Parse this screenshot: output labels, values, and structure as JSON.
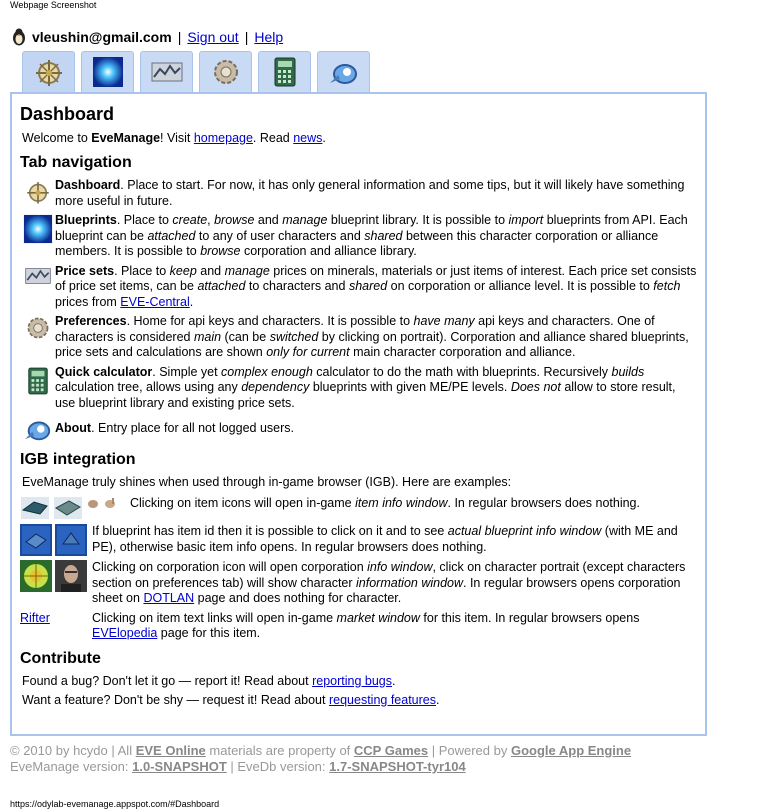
{
  "caption": "Webpage Screenshot",
  "status_url": "https://odylab-evemanage.appspot.com/#Dashboard",
  "user": {
    "email": "vleushin@gmail.com",
    "sign_out": "Sign out",
    "help": "Help",
    "sep": "|"
  },
  "tabs": [
    {
      "icon": "dashboard-compass-icon"
    },
    {
      "icon": "blueprint-glow-icon"
    },
    {
      "icon": "price-chart-icon"
    },
    {
      "icon": "preferences-gear-icon"
    },
    {
      "icon": "calculator-icon"
    },
    {
      "icon": "about-satellite-icon"
    }
  ],
  "dashboard": {
    "title": "Dashboard",
    "welcome_pre": "Welcome to ",
    "welcome_brand": "EveManage",
    "welcome_mid": "! Visit ",
    "homepage": "homepage",
    "welcome_read": ". Read ",
    "news": "news",
    "welcome_end": "."
  },
  "tabnav": {
    "title": "Tab navigation",
    "dash_name": "Dashboard",
    "dash_text": ". Place to start. For now, it has only general information and some tips, but it will likely have something more useful in future.",
    "bp_name": "Blueprints",
    "bp_t1": ". Place to ",
    "bp_i1": "create",
    "bp_t2": ", ",
    "bp_i2": "browse",
    "bp_t3": " and ",
    "bp_i3": "manage",
    "bp_t4": " blueprint library. It is possible to ",
    "bp_i4": "import",
    "bp_t5": " blueprints from API. Each blueprint can be ",
    "bp_i5": "attached",
    "bp_t6": " to any of user characters and ",
    "bp_i6": "shared",
    "bp_t7": " between this character corporation or alliance members. It is possible to ",
    "bp_i7": "browse",
    "bp_t8": " corporation and alliance library.",
    "ps_name": "Price sets",
    "ps_t1": ". Place to ",
    "ps_i1": "keep",
    "ps_t2": " and ",
    "ps_i2": "manage",
    "ps_t3": " prices on minerals, materials or just items of interest. Each price set consists of price set items, can be ",
    "ps_i3": "attached",
    "ps_t4": " to characters and ",
    "ps_i4": "shared",
    "ps_t5": " on corporation or alliance level. It is possible to ",
    "ps_i5": "fetch",
    "ps_t6": " prices from ",
    "ps_link": "EVE-Central",
    "ps_t7": ".",
    "pr_name": "Preferences",
    "pr_t1": ". Home for api keys and characters. It is possible to ",
    "pr_i1": "have many",
    "pr_t2": " api keys and characters. One of characters is considered ",
    "pr_i2": "main",
    "pr_t3": " (can be ",
    "pr_i3": "switched",
    "pr_t4": " by clicking on portrait). Corporation and alliance shared blueprints, price sets and calculations are shown ",
    "pr_i4": "only for current",
    "pr_t5": " main character corporation and alliance.",
    "qc_name": "Quick calculator",
    "qc_t1": ". Simple yet ",
    "qc_i1": "complex enough",
    "qc_t2": " calculator to do the math with blueprints. Recursively ",
    "qc_i2": "builds",
    "qc_t3": " calculation tree, allows using any ",
    "qc_i3": "dependency",
    "qc_t4": " blueprints with given ME/PE levels. ",
    "qc_i4": "Does not",
    "qc_t5": " allow to store result, use blueprint library and existing price sets.",
    "ab_name": "About",
    "ab_text": ". Entry place for all not logged users."
  },
  "igb": {
    "title": "IGB integration",
    "intro": "EveManage truly shines when used through in-game browser (IGB). Here are examples:",
    "r1_t1": "Clicking on item icons will open in-game ",
    "r1_i1": "item info window",
    "r1_t2": ". In regular browsers does nothing.",
    "r2_t1": "If blueprint has item id then it is possible to click on it and to see ",
    "r2_i1": "actual blueprint info window",
    "r2_t2": " (with ME and PE), otherwise basic item info opens. In regular browsers does nothing.",
    "r3_t1": "Clicking on corporation icon will open corporation ",
    "r3_i1": "info window",
    "r3_t2": ", click on character portrait (except characters section on preferences tab) will show character ",
    "r3_i2": "information window",
    "r3_t3": ". In regular browsers opens corporation sheet on ",
    "r3_link": "DOTLAN",
    "r3_t4": " page and does nothing for character.",
    "r4_link": "Rifter",
    "r4_t1": "Clicking on item text links will open in-game ",
    "r4_i1": "market window",
    "r4_t2": " for this item. In regular browsers opens ",
    "r4_link2": "EVElopedia",
    "r4_t3": " page for this item."
  },
  "contribute": {
    "title": "Contribute",
    "bug_t1": "Found a bug? Don't let it go — report it! Read about ",
    "bug_link": "reporting bugs",
    "bug_t2": ".",
    "feat_t1": "Want a feature? Don't be shy — request it! Read about ",
    "feat_link": "requesting features",
    "feat_t2": "."
  },
  "footer": {
    "l1_a": "© 2010 by hcydo | All ",
    "eve": "EVE Online",
    "l1_b": " materials are property of ",
    "ccp": "CCP Games",
    "l1_c": " | Powered by ",
    "gae": "Google App Engine",
    "l2_a": "EveManage version: ",
    "ver": "1.0-SNAPSHOT",
    "l2_b": " | EveDb version: ",
    "dbver": "1.7-SNAPSHOT-tyr104"
  }
}
